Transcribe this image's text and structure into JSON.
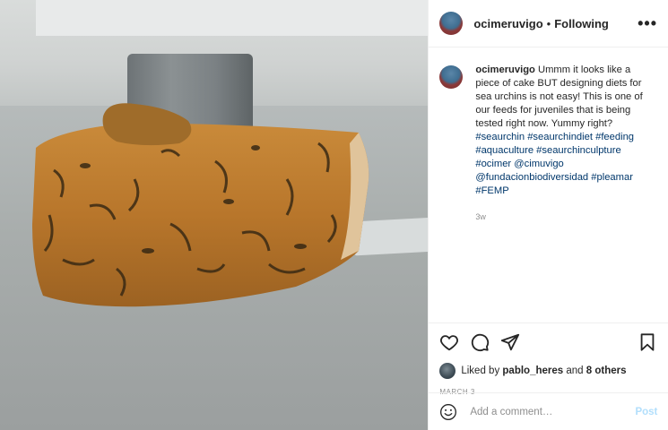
{
  "header": {
    "username": "ocimeruvigo",
    "dot": "•",
    "follow_status": "Following",
    "more": "•••"
  },
  "caption": {
    "username": "ocimeruvigo",
    "text": "Ummm it looks like a piece of cake BUT designing diets for sea urchins is not easy! This is one of our feeds for juveniles that is being tested right now. Yummy right?",
    "hashtags1": [
      "#seaurchin",
      "#seaurchindiet",
      "#feeding",
      "#aquaculture",
      "#seaurchinculpture",
      "#ocimer"
    ],
    "mention1": "@cimuvigo",
    "mention2": "@fundacionbiodiversidad",
    "hashtags2": [
      "#pleamar",
      "#FEMP"
    ],
    "time_ago": "3w"
  },
  "likes": {
    "prefix": "Liked by",
    "user": "pablo_heres",
    "and": "and",
    "others": "8 others"
  },
  "date": "MARCH 3",
  "comment": {
    "placeholder": "Add a comment…",
    "post_label": "Post"
  },
  "icons": {
    "like": "heart-icon",
    "comment": "comment-icon",
    "share": "share-icon",
    "save": "bookmark-icon",
    "emoji": "emoji-icon"
  },
  "colors": {
    "link": "#00376b",
    "muted": "#8e8e8e",
    "post_disabled": "#b2dffc"
  }
}
